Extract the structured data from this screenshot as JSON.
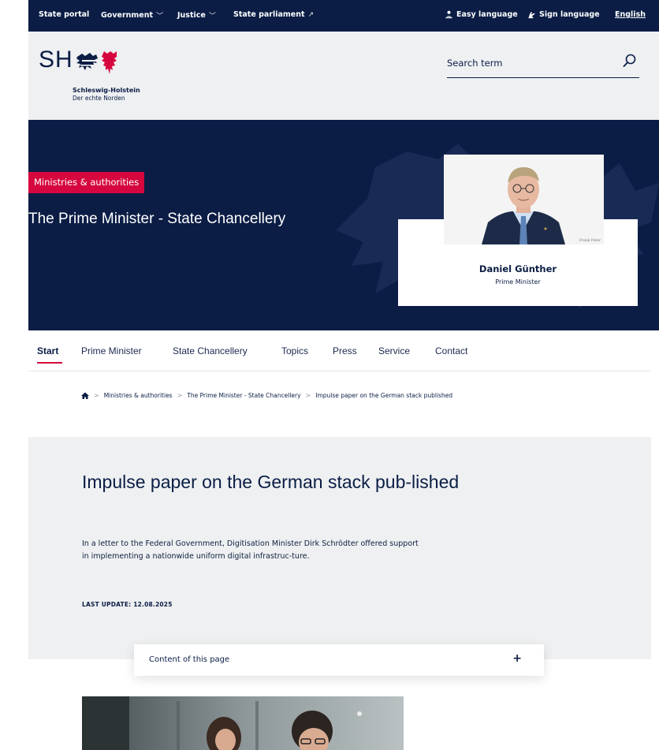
{
  "topbar": {
    "state_portal": "State portal",
    "government": "Government",
    "justice": "Justice",
    "state_parliament": "State parliament",
    "easy_language": "Easy language",
    "sign_language": "Sign language",
    "english": "English"
  },
  "header": {
    "logo_text": "SH",
    "logo_name": "Schleswig-Holstein",
    "logo_sub": "Der echte Norden",
    "search_placeholder": "Search term"
  },
  "hero": {
    "badge": "Ministries & authorities",
    "title": "The Prime Minister - State Chancellery",
    "person_name": "Daniel Günther",
    "person_role": "Prime Minister",
    "photo_credit": "Frank Peter"
  },
  "nav": {
    "tabs": [
      {
        "label": "Start"
      },
      {
        "label": "Prime Minister"
      },
      {
        "label": "State Chancellery"
      },
      {
        "label": "Topics"
      },
      {
        "label": "Press"
      },
      {
        "label": "Service"
      },
      {
        "label": "Contact"
      }
    ],
    "active": "Start"
  },
  "breadcrumb": {
    "items": [
      "Ministries & authorities",
      "The Prime Minister - State Chancellery",
      "Impulse paper on the German stack published"
    ]
  },
  "article": {
    "title": "Impulse paper on the German stack pub-lished",
    "lead": "In a letter to the Federal Government, Digitisation Minister Dirk Schrödter offered support in implementing a nationwide uniform digital infrastruc-ture.",
    "last_update": "LAST UPDATE: 12.08.2025",
    "toc_label": "Content of this page",
    "toc_toggle": "+"
  },
  "colors": {
    "navy": "#0b1d45",
    "accent_red": "#d6073e",
    "light_gray": "#eef0f2"
  }
}
